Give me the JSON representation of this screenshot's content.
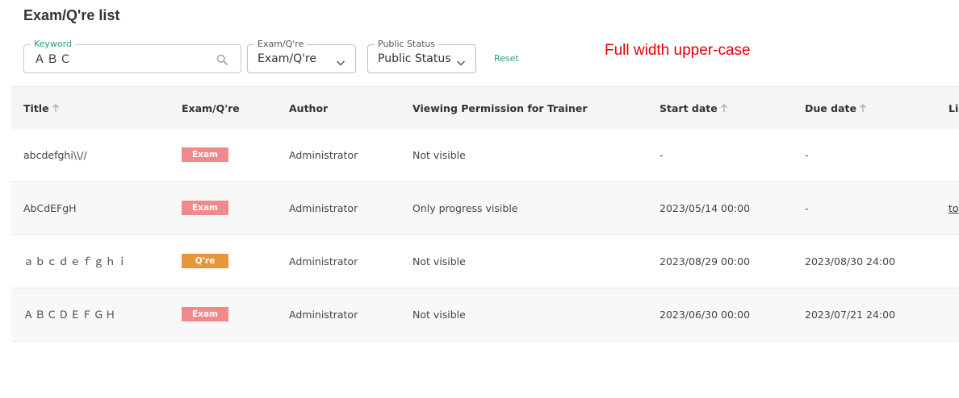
{
  "page": {
    "title": "Exam/Q're list"
  },
  "filters": {
    "keyword": {
      "legend": "Keyword",
      "value": "ＡＢＣ",
      "icon": "search-icon"
    },
    "type": {
      "legend": "Exam/Q're",
      "value": "Exam/Q're"
    },
    "status": {
      "legend": "Public Status",
      "value": "Public Status"
    },
    "reset_label": "Reset"
  },
  "annotation": "Full width upper-case",
  "colors": {
    "accent": "#2e9d7a",
    "exam_badge": "#f08a8a",
    "qre_badge": "#e8963a",
    "annotation": "#e60000"
  },
  "table": {
    "columns": {
      "title": "Title",
      "type": "Exam/Q're",
      "author": "Author",
      "permission": "Viewing Permission for Trainer",
      "start": "Start date",
      "due": "Due date",
      "link": "Li"
    },
    "rows": [
      {
        "title": "abcdefghi\\\\//",
        "type": "Exam",
        "author": "Administrator",
        "permission": "Not visible",
        "start": "-",
        "due": "-",
        "link": ""
      },
      {
        "title": "AbCdEFgH",
        "type": "Exam",
        "author": "Administrator",
        "permission": "Only progress visible",
        "start": "2023/05/14 00:00",
        "due": "-",
        "link": "to"
      },
      {
        "title": "ａｂｃｄｅｆｇｈｉ",
        "type": "Q're",
        "author": "Administrator",
        "permission": "Not visible",
        "start": "2023/08/29 00:00",
        "due": "2023/08/30 24:00",
        "link": ""
      },
      {
        "title": "ＡＢＣＤＥＦＧＨ",
        "type": "Exam",
        "author": "Administrator",
        "permission": "Not visible",
        "start": "2023/06/30 00:00",
        "due": "2023/07/21 24:00",
        "link": ""
      }
    ]
  }
}
